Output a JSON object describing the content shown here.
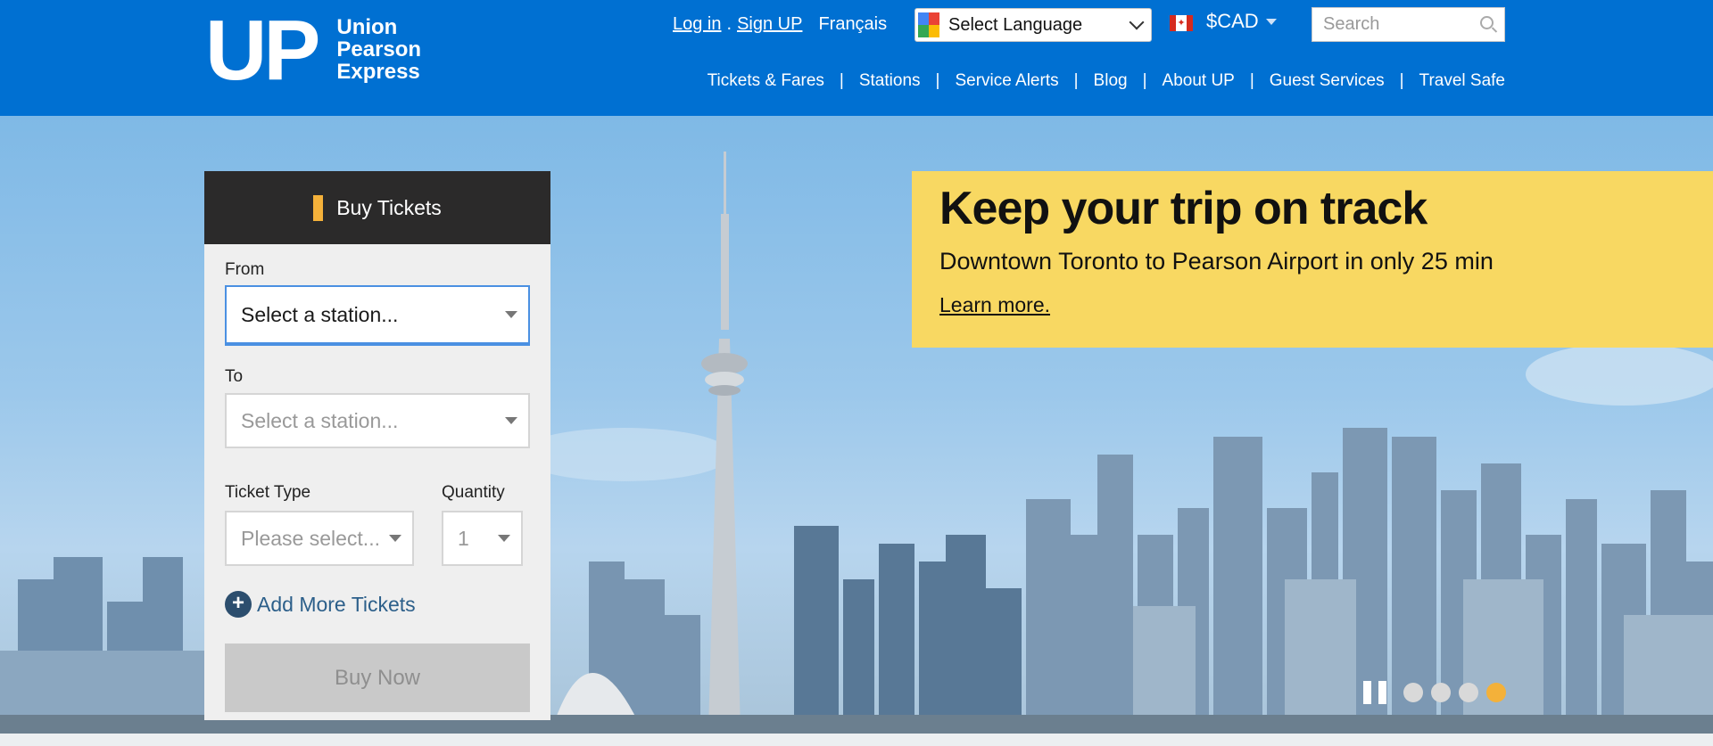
{
  "brand": {
    "logo_mark": "UP",
    "logo_line1": "Union",
    "logo_line2": "Pearson",
    "logo_line3": "Express"
  },
  "toplinks": {
    "login": "Log in",
    "separator": ".",
    "signup": "Sign UP",
    "french": "Français"
  },
  "language": {
    "selected": "Select Language",
    "icon": "google-translate-icon"
  },
  "currency": {
    "label": "$CAD",
    "flag": "canada-flag-icon"
  },
  "search": {
    "placeholder": "Search",
    "icon": "search-icon"
  },
  "nav": {
    "items": [
      "Tickets & Fares",
      "Stations",
      "Service Alerts",
      "Blog",
      "About UP",
      "Guest Services",
      "Travel Safe"
    ],
    "separator": "|"
  },
  "buy_panel": {
    "title": "Buy Tickets",
    "from_label": "From",
    "from_value": "Select a station...",
    "to_label": "To",
    "to_value": "Select a station...",
    "ticket_type_label": "Ticket Type",
    "ticket_type_value": "Please select...",
    "quantity_label": "Quantity",
    "quantity_value": "1",
    "add_more": "Add More Tickets",
    "buy_now": "Buy Now"
  },
  "promo": {
    "headline": "Keep your trip on track",
    "subtext": "Downtown Toronto to Pearson Airport in only 25 min",
    "link": "Learn more."
  },
  "carousel": {
    "slide_count": 4,
    "active_index": 3
  },
  "colors": {
    "header_blue": "#0070d2",
    "panel_dark": "#2b2a2a",
    "accent_orange": "#f4b13a",
    "promo_yellow": "#f8d862",
    "button_gray": "#c9c9c9"
  }
}
